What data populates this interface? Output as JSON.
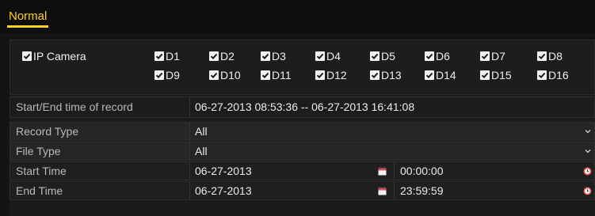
{
  "tab": {
    "label": "Normal"
  },
  "cameras": {
    "all_label": "IP Camera",
    "channels": [
      "D1",
      "D2",
      "D3",
      "D4",
      "D5",
      "D6",
      "D7",
      "D8",
      "D9",
      "D10",
      "D11",
      "D12",
      "D13",
      "D14",
      "D15",
      "D16"
    ]
  },
  "record_range": {
    "label": "Start/End time of record",
    "value": "06-27-2013 08:53:36 -- 06-27-2013 16:41:08"
  },
  "record_type": {
    "label": "Record Type",
    "value": "All"
  },
  "file_type": {
    "label": "File Type",
    "value": "All"
  },
  "start_time": {
    "label": "Start Time",
    "date": "06-27-2013",
    "time": "00:00:00"
  },
  "end_time": {
    "label": "End Time",
    "date": "06-27-2013",
    "time": "23:59:59"
  },
  "colors": {
    "accent": "#ffd21f",
    "background": "#141414",
    "calendar_icon": "#e0506a",
    "clock_icon": "#e8584a"
  },
  "icons": [
    "checkbox-checked-icon",
    "dropdown-arrow-icon",
    "calendar-icon",
    "clock-icon"
  ]
}
